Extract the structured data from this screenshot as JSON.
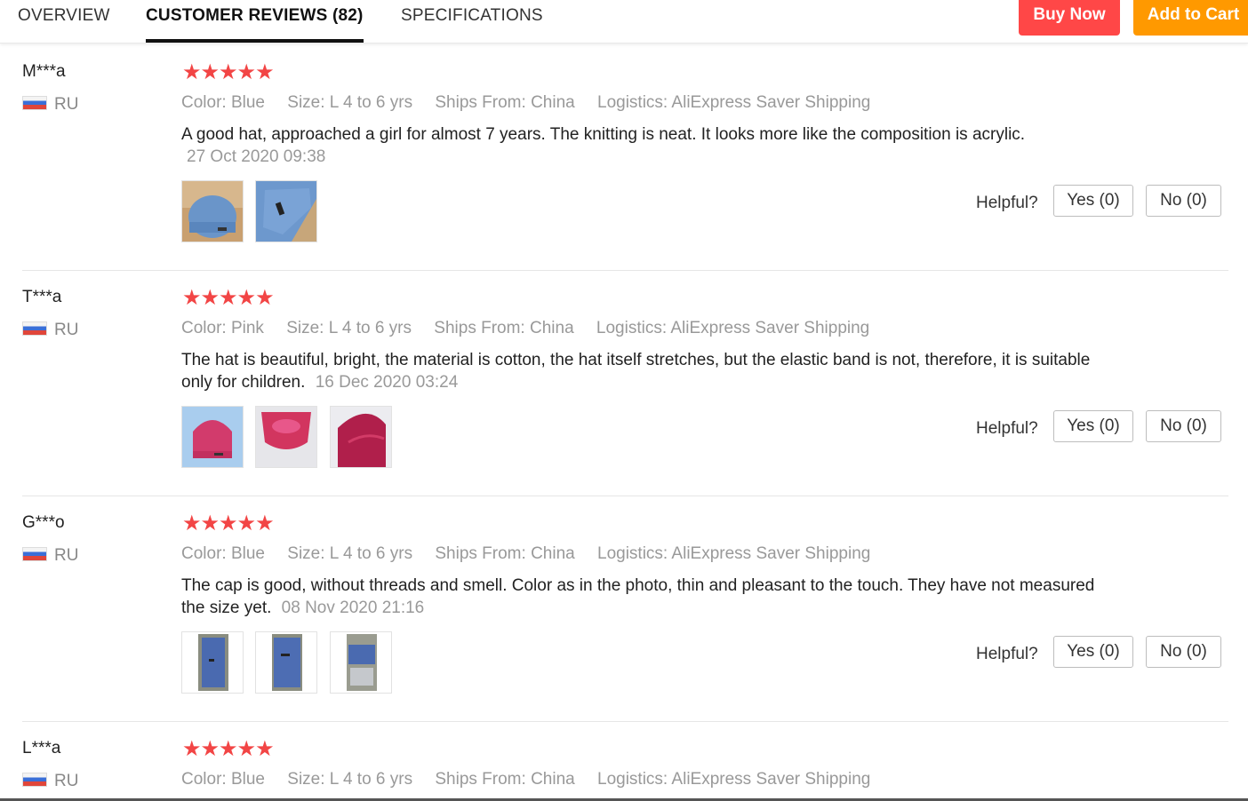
{
  "tabs": {
    "overview": "OVERVIEW",
    "reviews": "CUSTOMER REVIEWS (82)",
    "specs": "SPECIFICATIONS"
  },
  "actions": {
    "buy_now": "Buy Now",
    "add_to_cart": "Add to Cart"
  },
  "colors": {
    "star": "#f24545",
    "buy_now": "#ff4747",
    "add_to_cart": "#ff9900"
  },
  "reviews": [
    {
      "user": "M***a",
      "country": "RU",
      "stars": "★★★★★",
      "color": "Color: Blue",
      "size": "Size: L 4 to 6 yrs",
      "ships": "Ships From: China",
      "logistics": "Logistics: AliExpress Saver Shipping",
      "text": "A good hat, approached a girl for almost 7 years. The knitting is neat. It looks more like the composition is acrylic.",
      "date": "27 Oct 2020 09:38",
      "helpful": "Helpful?",
      "yes": "Yes (0)",
      "no": "No (0)"
    },
    {
      "user": "T***a",
      "country": "RU",
      "stars": "★★★★★",
      "color": "Color: Pink",
      "size": "Size: L 4 to 6 yrs",
      "ships": "Ships From: China",
      "logistics": "Logistics: AliExpress Saver Shipping",
      "text": "The hat is beautiful, bright, the material is cotton, the hat itself stretches, but the elastic band is not, therefore, it is suitable only for children.",
      "date": "16 Dec 2020 03:24",
      "helpful": "Helpful?",
      "yes": "Yes (0)",
      "no": "No (0)"
    },
    {
      "user": "G***o",
      "country": "RU",
      "stars": "★★★★★",
      "color": "Color: Blue",
      "size": "Size: L 4 to 6 yrs",
      "ships": "Ships From: China",
      "logistics": "Logistics: AliExpress Saver Shipping",
      "text": "The cap is good, without threads and smell. Color as in the photo, thin and pleasant to the touch. They have not measured the size yet.",
      "date": "08 Nov 2020 21:16",
      "helpful": "Helpful?",
      "yes": "Yes (0)",
      "no": "No (0)"
    },
    {
      "user": "L***a",
      "country": "RU",
      "stars": "★★★★★",
      "color": "Color: Blue",
      "size": "Size: L 4 to 6 yrs",
      "ships": "Ships From: China",
      "logistics": "Logistics: AliExpress Saver Shipping"
    }
  ]
}
